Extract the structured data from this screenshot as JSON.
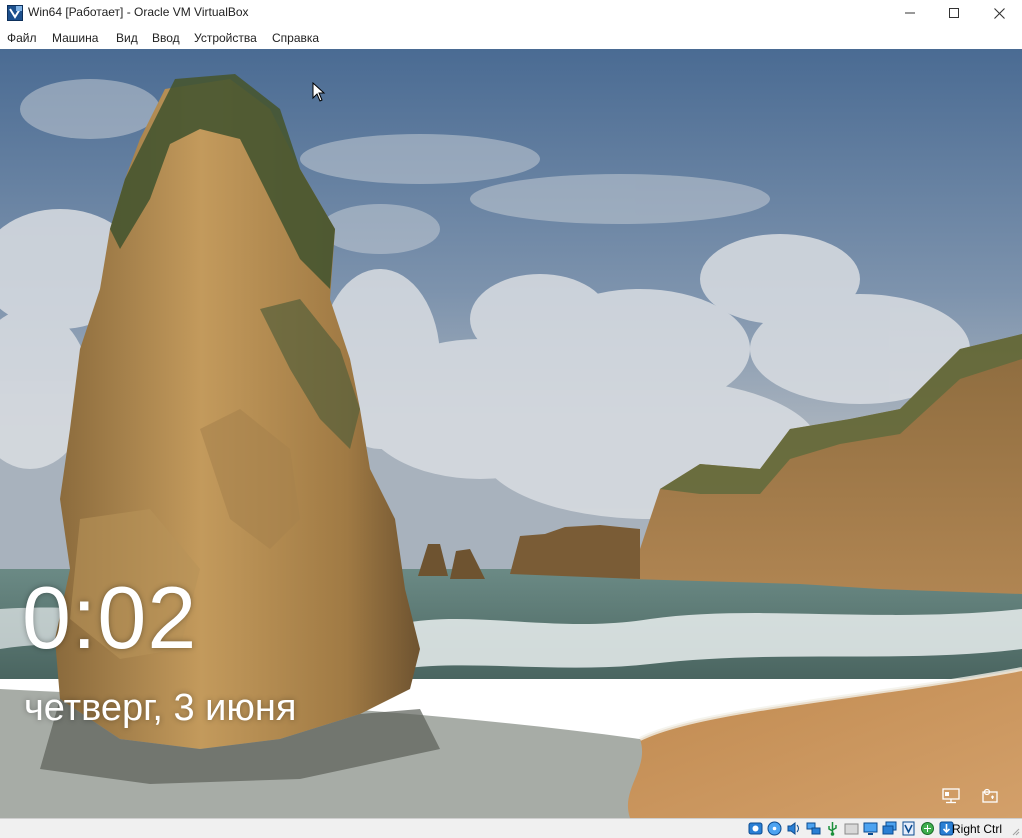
{
  "window": {
    "title": "Win64 [Работает] - Oracle VM VirtualBox",
    "app_icon": "virtualbox-icon",
    "controls": [
      "minimize-icon",
      "maximize-icon",
      "close-icon"
    ]
  },
  "menu": {
    "items": [
      "Файл",
      "Машина",
      "Вид",
      "Ввод",
      "Устройства",
      "Справка"
    ]
  },
  "lockscreen": {
    "time": "0:02",
    "date": "четверг, 3 июня",
    "icons": [
      "network-icon",
      "accessibility-icon"
    ]
  },
  "statusbar": {
    "icons": [
      "hard-disk-icon",
      "optical-drive-icon",
      "audio-icon",
      "network-adapter-icon",
      "usb-icon",
      "shared-folders-icon",
      "display-icon",
      "video-capture-icon",
      "cpu-icon",
      "virtualization-icon",
      "mouse-integration-icon",
      "keyboard-capture-icon"
    ],
    "host_key": "Right Ctrl"
  },
  "colors": {
    "titlebar_bg": "#ffffff",
    "statusbar_bg": "#f0f0f0",
    "sky_top": "#4a6b93",
    "sand": "#c8935a"
  }
}
